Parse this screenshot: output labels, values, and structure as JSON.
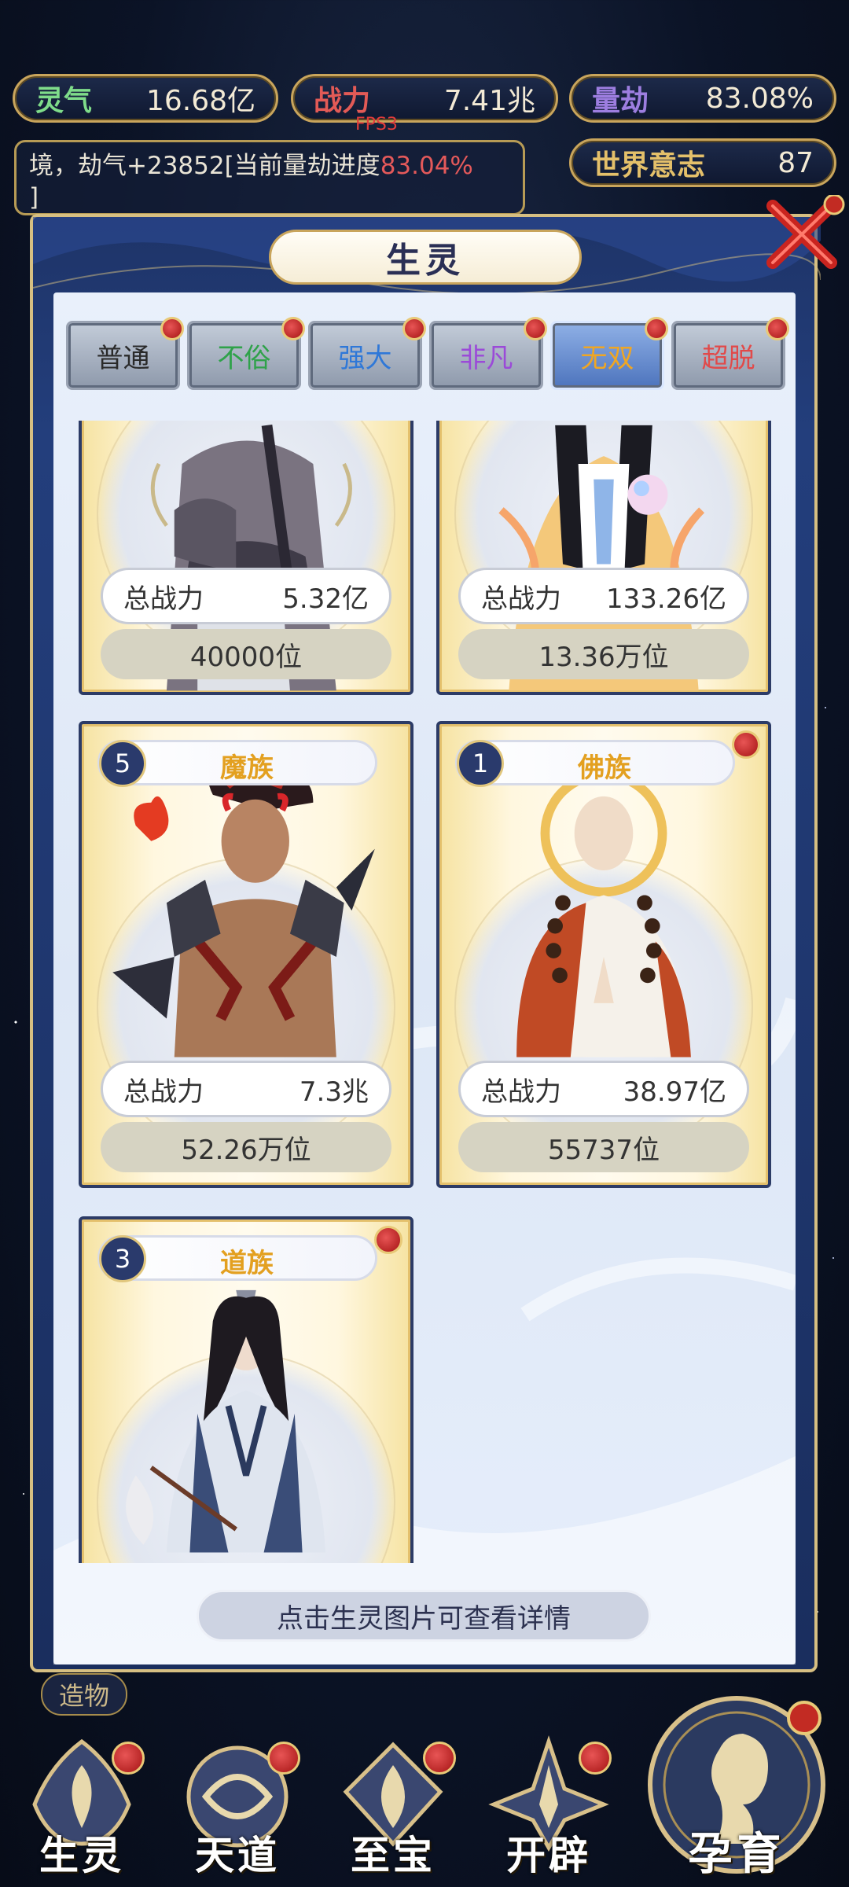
{
  "stats": {
    "lingqi": {
      "label": "灵气",
      "value": "16.68亿",
      "color": "#7fdc8a"
    },
    "zhanli": {
      "label": "战力",
      "value": "7.41兆",
      "color": "#e25a56"
    },
    "liangjie": {
      "label": "量劫",
      "value": "83.08%",
      "color": "#9d7ee0"
    },
    "shijie": {
      "label": "世界意志",
      "value": "87",
      "color": "#e4c06a"
    }
  },
  "fps": "FPS3",
  "log": {
    "line1": "境，劫气+23852[当前量劫进度",
    "line1_pct": "83.04%",
    "line2": "]"
  },
  "modal": {
    "title": "生灵",
    "tabs": [
      {
        "label": "普通",
        "color": "#2a2a2a",
        "active": false
      },
      {
        "label": "不俗",
        "color": "#2fa24a",
        "active": false
      },
      {
        "label": "强大",
        "color": "#2f78d8",
        "active": false
      },
      {
        "label": "非凡",
        "color": "#9b4ad8",
        "active": false
      },
      {
        "label": "无双",
        "color": "#f0a623",
        "active": true
      },
      {
        "label": "超脱",
        "color": "#e14a4a",
        "active": false
      }
    ],
    "cards": [
      {
        "num": "",
        "race": "",
        "power_label": "总战力",
        "power": "5.32亿",
        "rank": "40000位",
        "badge": false
      },
      {
        "num": "",
        "race": "",
        "power_label": "总战力",
        "power": "133.26亿",
        "rank": "13.36万位",
        "badge": false
      },
      {
        "num": "5",
        "race": "魔族",
        "power_label": "总战力",
        "power": "7.3兆",
        "rank": "52.26万位",
        "badge": false
      },
      {
        "num": "1",
        "race": "佛族",
        "power_label": "总战力",
        "power": "38.97亿",
        "rank": "55737位",
        "badge": true
      },
      {
        "num": "3",
        "race": "道族",
        "power_label": "",
        "power": "",
        "rank": "",
        "badge": true
      }
    ],
    "hint": "点击生灵图片可查看详情"
  },
  "nav": {
    "zaowu": "造物",
    "items": [
      "生灵",
      "天道",
      "至宝",
      "开辟"
    ],
    "big": "孕育"
  }
}
